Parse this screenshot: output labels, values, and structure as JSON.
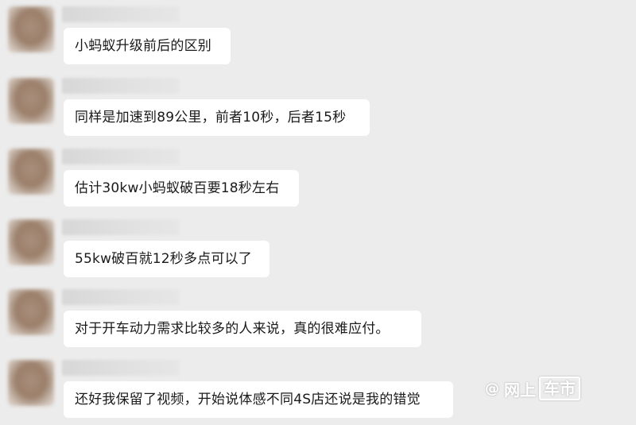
{
  "messages": [
    {
      "sender": "",
      "text": "小蚂蚁升级前后的区别"
    },
    {
      "sender": "",
      "text": "同样是加速到89公里，前者10秒，后者15秒"
    },
    {
      "sender": "",
      "text": "估计30kw小蚂蚁破百要18秒左右"
    },
    {
      "sender": "",
      "text": "55kw破百就12秒多点可以了"
    },
    {
      "sender": "",
      "text": "对于开车动力需求比较多的人来说，真的很难应付。"
    },
    {
      "sender": "",
      "text": "还好我保留了视频，开始说体感不同4S店还说是我的错觉"
    }
  ],
  "watermark": {
    "at": "@",
    "text_a": "网上",
    "text_b": "车市"
  }
}
